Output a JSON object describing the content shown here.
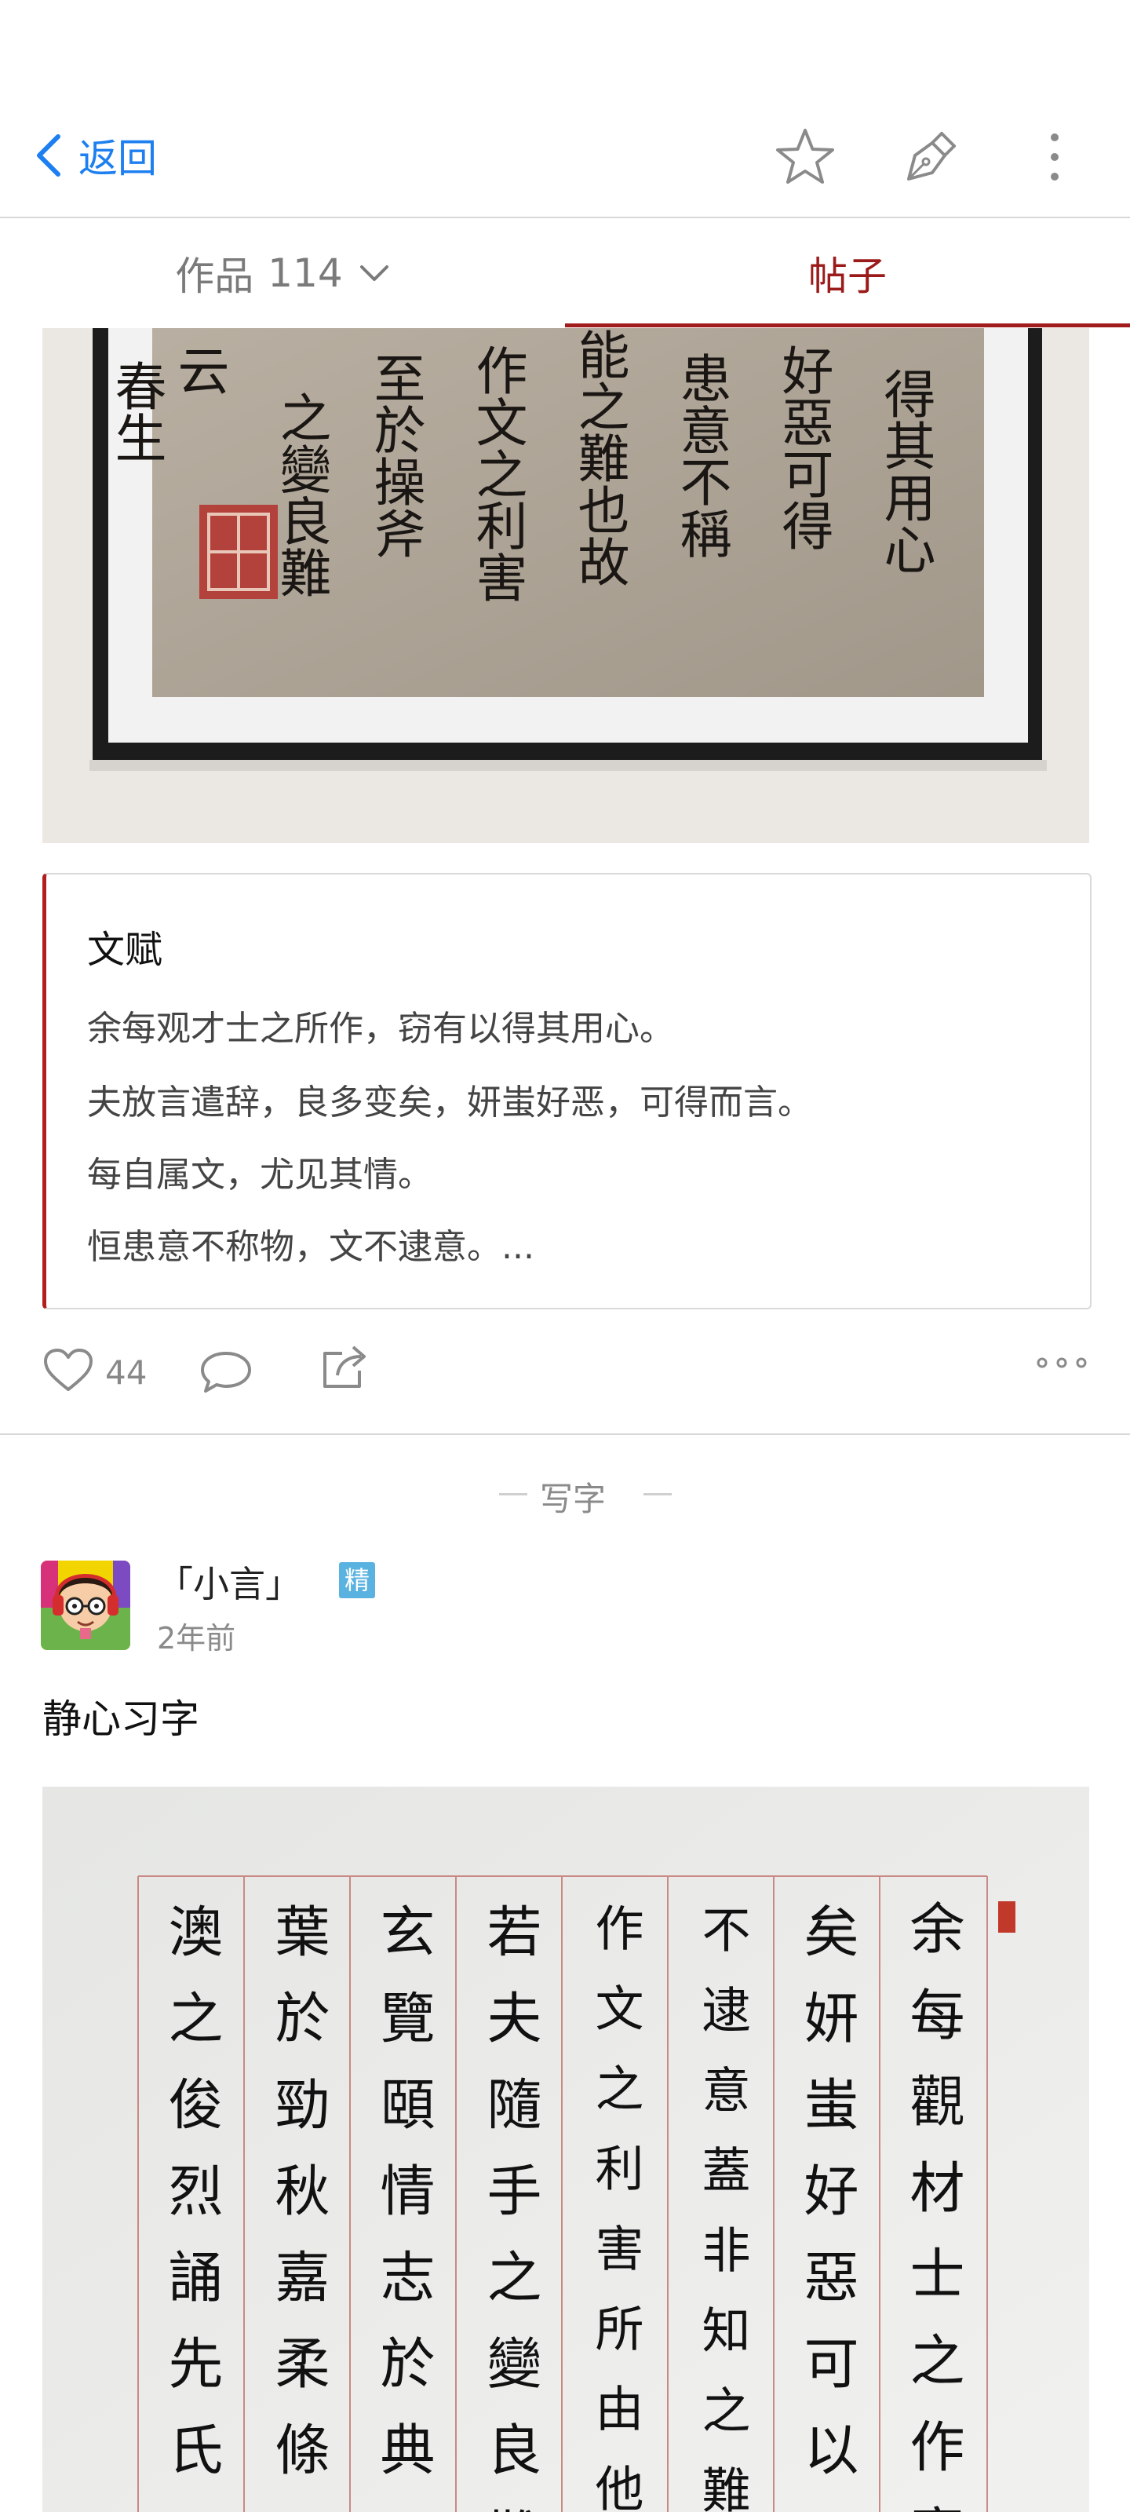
{
  "nav": {
    "back_label": "返回",
    "icons": [
      "star-icon",
      "pen-icon",
      "more-vertical-icon"
    ]
  },
  "tabs": {
    "works_label": "作品",
    "works_count": "114",
    "posts_label": "帖子",
    "active": "posts"
  },
  "post1": {
    "artwork_text": [
      "得其用心",
      "好惡可得",
      "患意不稱",
      "能之難也故",
      "作文之利害",
      "至於操斧",
      "之變良難",
      "云",
      "春生"
    ],
    "quote_title": "文赋",
    "quote_lines": [
      "余每观才士之所作，窃有以得其用心。",
      "夫放言遣辞，良多变矣，妍蚩好恶，可得而言。",
      "每自属文，尤见其情。",
      "恒患意不称物，文不逮意。..."
    ],
    "likes": "44"
  },
  "section": {
    "label": "写字"
  },
  "post2": {
    "user_name": "「小言」",
    "badge": "精",
    "time": "2年前",
    "title": "静心习字",
    "artwork_columns": [
      "余每觀材士之作竊",
      "矣妍蚩好惡可以而",
      "不逮意蓋非知之難能",
      "作文之利害所由他日",
      "若夫隨手之變良難",
      "玄覽頤情志於典",
      "葉於勁秋嘉柔條",
      "澳之俊烈誦先氏"
    ]
  },
  "colors": {
    "accent_blue": "#1d7ff0",
    "active_tab_red": "#a11d1d",
    "badge_blue": "#5ab2e0"
  }
}
